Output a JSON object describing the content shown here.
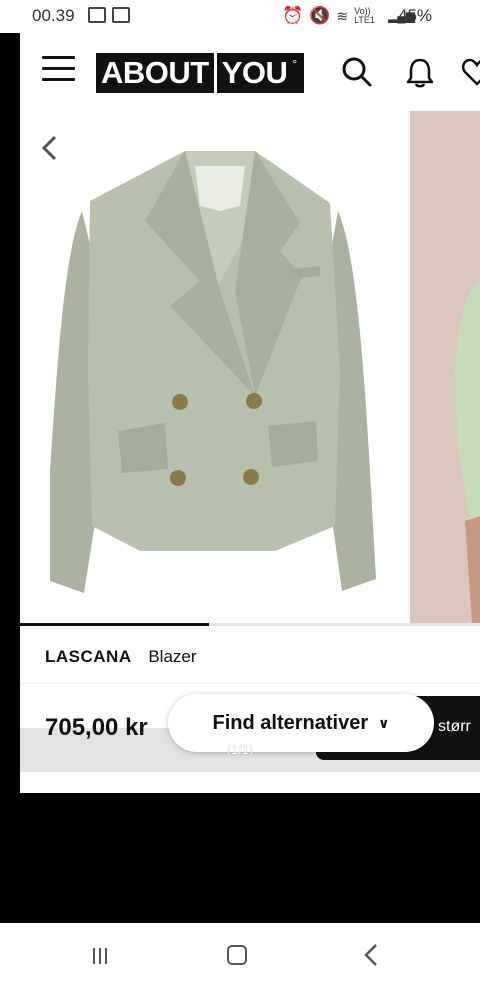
{
  "status_bar": {
    "time": "00.39",
    "network": "Vo)) LTE1",
    "battery": "45%"
  },
  "header": {
    "logo_left": "ABOUT",
    "logo_right": "YOU"
  },
  "product": {
    "brand": "LASCANA",
    "name": "Blazer",
    "price": "705,00 kr",
    "image_counter": "(1/1)",
    "gallery_progress": 0.41
  },
  "actions": {
    "find_alternatives": "Find alternativer",
    "size_button_partial": "størr"
  },
  "icons": {
    "menu": "hamburger-icon",
    "search": "search-icon",
    "notifications": "bell-icon",
    "wishlist": "heart-icon",
    "gallery_back": "chevron-left-icon",
    "dropdown": "chevron-down-icon"
  },
  "colors": {
    "brand": "#111111",
    "blazer": "#b8c1ad",
    "buttons": "#8a7a4a"
  }
}
